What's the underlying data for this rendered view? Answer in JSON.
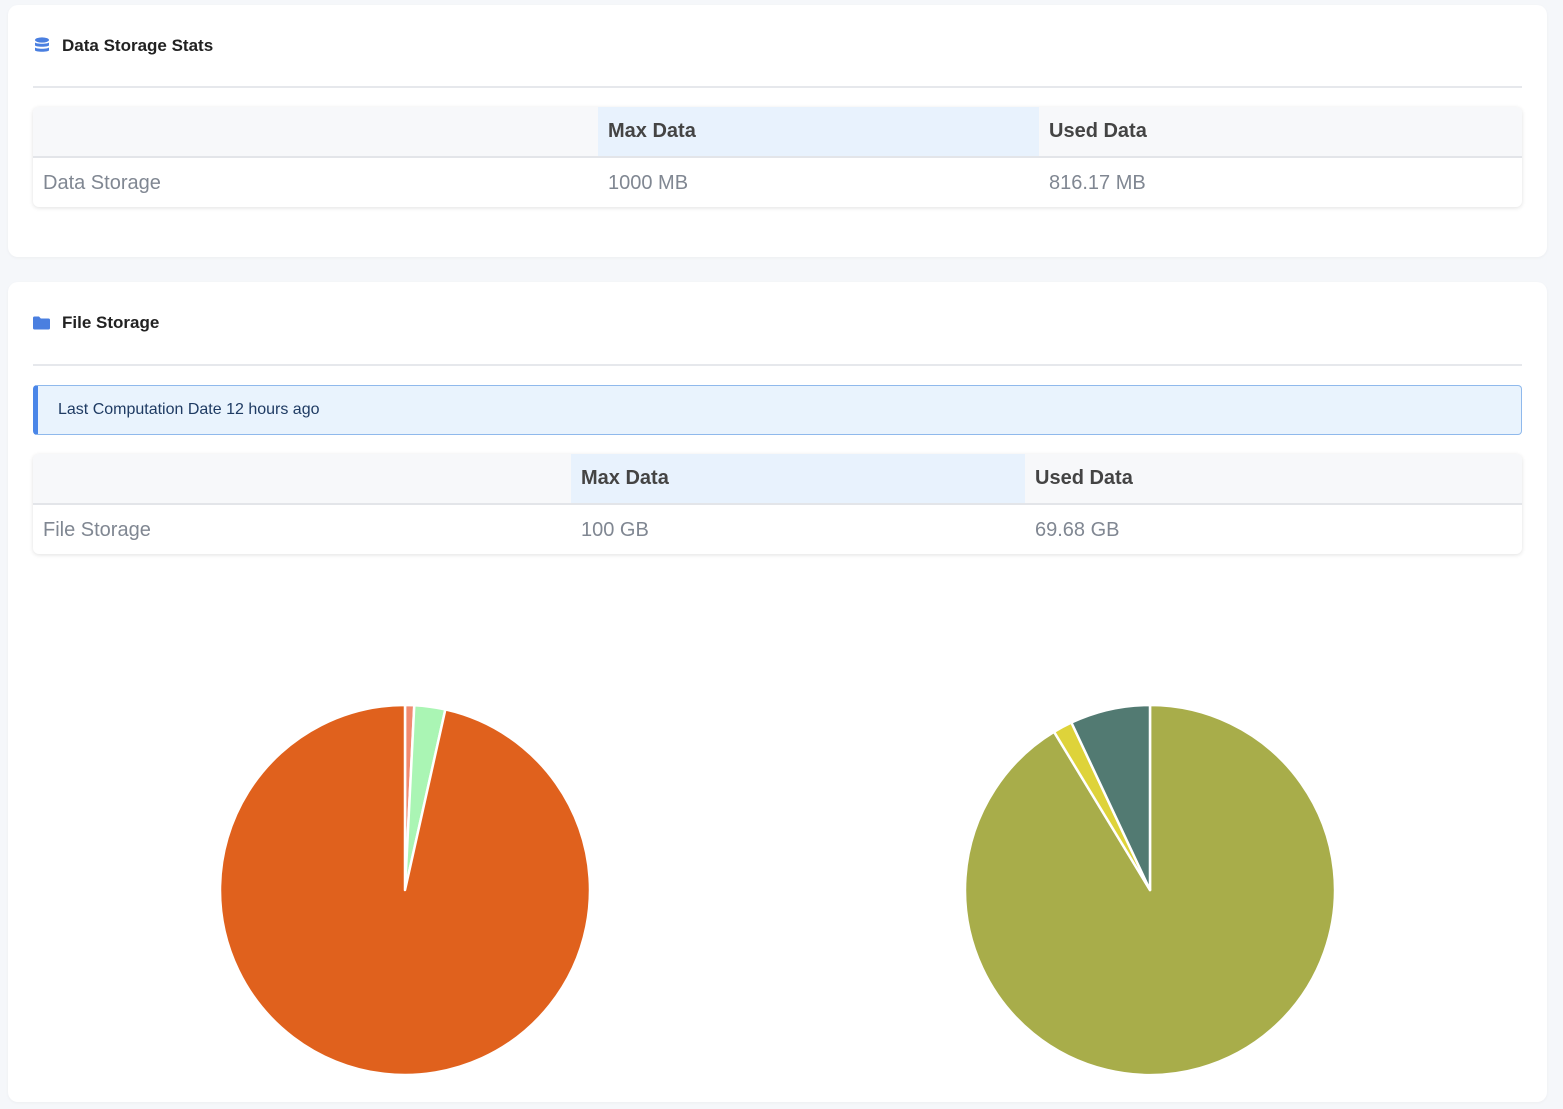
{
  "data_storage": {
    "title": "Data Storage Stats",
    "icon": "database-icon",
    "table": {
      "headers": [
        "",
        "Max Data",
        "Used Data"
      ],
      "row": {
        "label": "Data Storage",
        "max": "1000 MB",
        "used": "816.17 MB"
      }
    }
  },
  "file_storage": {
    "title": "File Storage",
    "icon": "folder-icon",
    "info": "Last Computation Date 12 hours ago",
    "table": {
      "headers": [
        "",
        "Max Data",
        "Used Data"
      ],
      "row": {
        "label": "File Storage",
        "max": "100 GB",
        "used": "69.68 GB"
      }
    }
  },
  "colors": {
    "accent": "#4a86e8"
  },
  "chart_data": [
    {
      "type": "pie",
      "slices": [
        {
          "value": 0.8,
          "color": "#f08a70"
        },
        {
          "value": 2.7,
          "color": "#aaf5b4"
        },
        {
          "value": 96.5,
          "color": "#e0611d"
        }
      ]
    },
    {
      "type": "pie",
      "slices": [
        {
          "value": 86.3,
          "color": "#a8ad4a"
        },
        {
          "value": 1.6,
          "color": "#ded33a"
        },
        {
          "value": 6.6,
          "color": "#527a72"
        }
      ],
      "note_order": "clockwise from top"
    }
  ]
}
